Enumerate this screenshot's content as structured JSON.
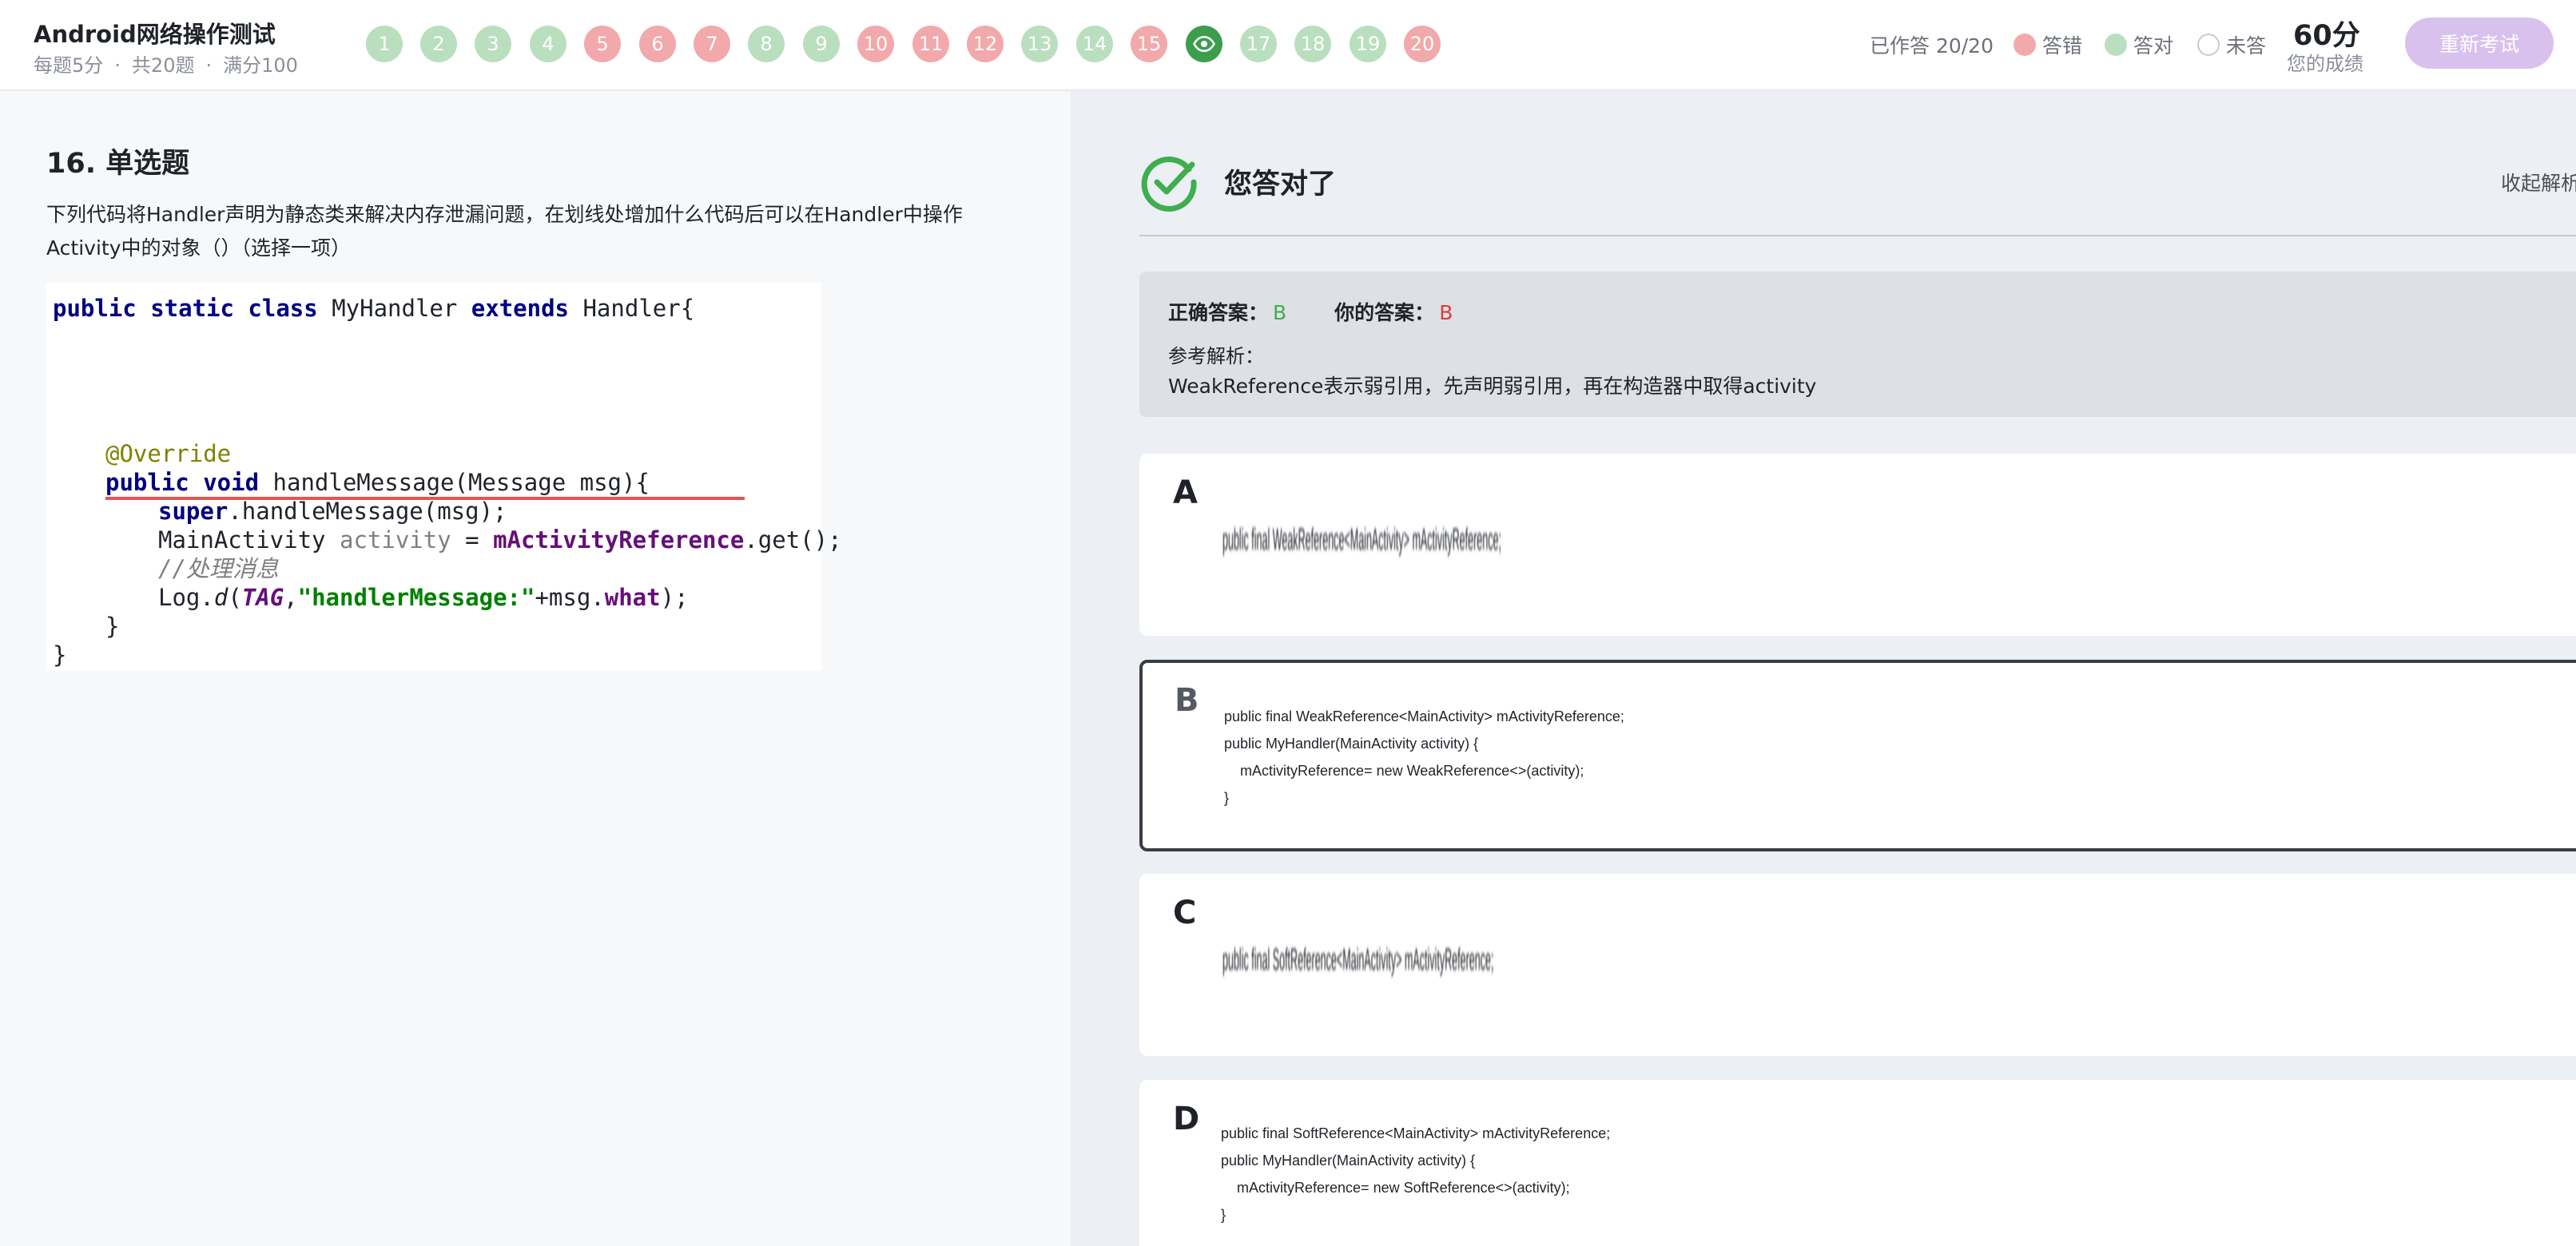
{
  "header": {
    "title": "Android网络操作测试",
    "meta": [
      "每题5分",
      "·",
      "共20题",
      "·",
      "满分100"
    ],
    "questions": [
      {
        "num": "1",
        "state": "ok"
      },
      {
        "num": "2",
        "state": "ok"
      },
      {
        "num": "3",
        "state": "ok"
      },
      {
        "num": "4",
        "state": "ok"
      },
      {
        "num": "5",
        "state": "bad"
      },
      {
        "num": "6",
        "state": "bad"
      },
      {
        "num": "7",
        "state": "bad"
      },
      {
        "num": "8",
        "state": "ok"
      },
      {
        "num": "9",
        "state": "ok"
      },
      {
        "num": "10",
        "state": "bad"
      },
      {
        "num": "11",
        "state": "bad"
      },
      {
        "num": "12",
        "state": "bad"
      },
      {
        "num": "13",
        "state": "ok"
      },
      {
        "num": "14",
        "state": "ok"
      },
      {
        "num": "15",
        "state": "bad"
      },
      {
        "num": "16",
        "state": "cur"
      },
      {
        "num": "17",
        "state": "ok"
      },
      {
        "num": "18",
        "state": "ok"
      },
      {
        "num": "19",
        "state": "ok"
      },
      {
        "num": "20",
        "state": "bad"
      }
    ],
    "answered": "已作答 20/20",
    "legend": {
      "wrong": "答错",
      "right": "答对",
      "unanswered": "未答"
    },
    "score": "60分",
    "score_label": "您的成绩",
    "retake": "重新考试"
  },
  "question": {
    "title": "16. 单选题",
    "text": "下列代码将Handler声明为静态类来解决内存泄漏问题，在划线处增加什么代码后可以在Handler中操作Activity中的对象（）（选择一项）",
    "code": {
      "l1_kw": "public static class",
      "l1_name": " MyHandler ",
      "l1_kw2": "extends",
      "l1_rest": " Handler{",
      "l2": "@Override",
      "l3_kw": "public void",
      "l3_rest": " handleMessage(Message msg){",
      "l4_kw": "super",
      "l4_rest": ".handleMessage(msg);",
      "l5_a": "MainActivity ",
      "l5_b": "activity",
      "l5_c": " = ",
      "l5_d": "mActivityReference",
      "l5_e": ".get();",
      "l6": "//处理消息",
      "l7_a": "Log.",
      "l7_b": "d",
      "l7_c": "(",
      "l7_d": "TAG",
      "l7_e": ",",
      "l7_f": "\"handlerMessage:\"",
      "l7_g": "+msg.",
      "l7_h": "what",
      "l7_i": ");",
      "l8": "}",
      "l9": "}"
    }
  },
  "result": {
    "status": "您答对了",
    "collapse": "收起解析",
    "correct_label": "正确答案：",
    "correct_value": "B",
    "yours_label": "你的答案：",
    "yours_value": "B",
    "ref_label": "参考解析：",
    "ref_text": "WeakReference表示弱引用，先声明弱引用，再在构造器中取得activity"
  },
  "options": [
    {
      "letter": "A",
      "code": "public final WeakReference<MainActivity> mActivityReference;"
    },
    {
      "letter": "B",
      "code": [
        "public final WeakReference<MainActivity> mActivityReference;",
        "public MyHandler(MainActivity activity) {",
        "    mActivityReference= new WeakReference<>(activity);",
        "}"
      ]
    },
    {
      "letter": "C",
      "code": "public final SoftReference<MainActivity> mActivityReference;"
    },
    {
      "letter": "D",
      "code": [
        "public final SoftReference<MainActivity> mActivityReference;",
        "public MyHandler(MainActivity activity) {",
        "    mActivityReference= new SoftReference<>(activity);",
        "}"
      ]
    }
  ],
  "colors": {
    "correct": "#3fae4f",
    "wrong": "#e03a3a",
    "dot_ok": "#b9dfbf",
    "dot_bad": "#f2a9ab",
    "dot_current": "#3c9d4c",
    "retake_bg": "#d9c1ee"
  }
}
